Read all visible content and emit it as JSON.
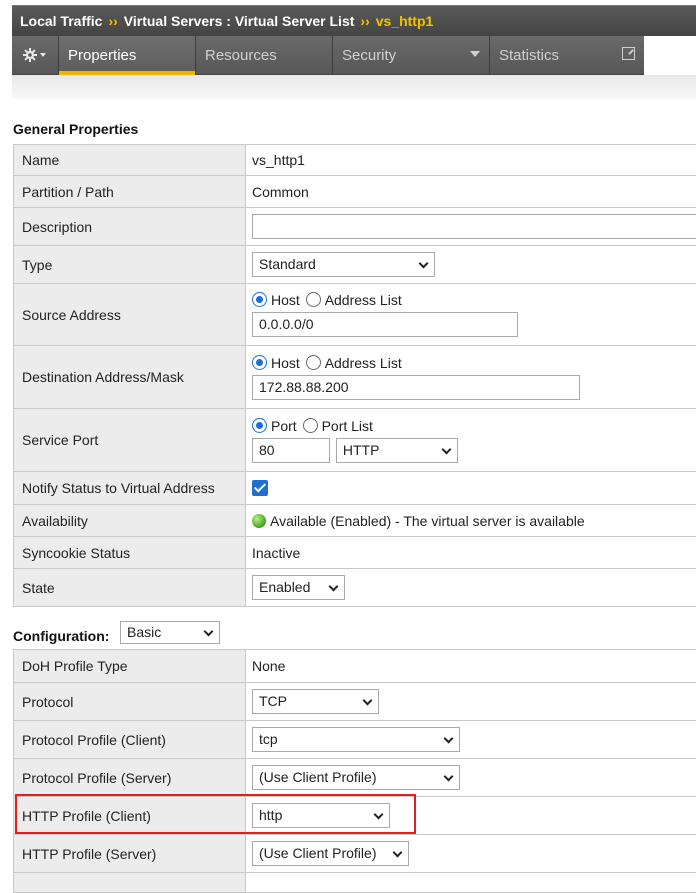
{
  "breadcrumb": {
    "items": [
      "Local Traffic",
      "Virtual Servers : Virtual Server List"
    ],
    "current": "vs_http1",
    "separator": "››"
  },
  "tabs": [
    {
      "label": "Properties",
      "active": true
    },
    {
      "label": "Resources"
    },
    {
      "label": "Security"
    },
    {
      "label": "Statistics"
    }
  ],
  "general": {
    "title": "General Properties",
    "name_label": "Name",
    "name_value": "vs_http1",
    "partition_label": "Partition / Path",
    "partition_value": "Common",
    "description_label": "Description",
    "description_value": "",
    "type_label": "Type",
    "type_value": "Standard",
    "source_label": "Source Address",
    "source_host": "Host",
    "source_list": "Address List",
    "source_value": "0.0.0.0/0",
    "dest_label": "Destination Address/Mask",
    "dest_host": "Host",
    "dest_list": "Address List",
    "dest_value": "172.88.88.200",
    "port_label": "Service Port",
    "port_opt": "Port",
    "port_list_opt": "Port List",
    "port_value": "80",
    "port_service": "HTTP",
    "notify_label": "Notify Status to Virtual Address",
    "avail_label": "Availability",
    "avail_value": "Available (Enabled) - The virtual server is available",
    "syncookie_label": "Syncookie Status",
    "syncookie_value": "Inactive",
    "state_label": "State",
    "state_value": "Enabled"
  },
  "config": {
    "title": "Configuration:",
    "mode": "Basic",
    "doh_label": "DoH Profile Type",
    "doh_value": "None",
    "protocol_label": "Protocol",
    "protocol_value": "TCP",
    "ppc_label": "Protocol Profile (Client)",
    "ppc_value": "tcp",
    "pps_label": "Protocol Profile (Server)",
    "pps_value": "(Use Client Profile)",
    "hpc_label": "HTTP Profile (Client)",
    "hpc_value": "http",
    "hps_label": "HTTP Profile (Server)",
    "hps_value": "(Use Client Profile)"
  },
  "colors": {
    "accent": "#f2b300",
    "highlight": "#e02020",
    "radio": "#1f6fd1"
  }
}
